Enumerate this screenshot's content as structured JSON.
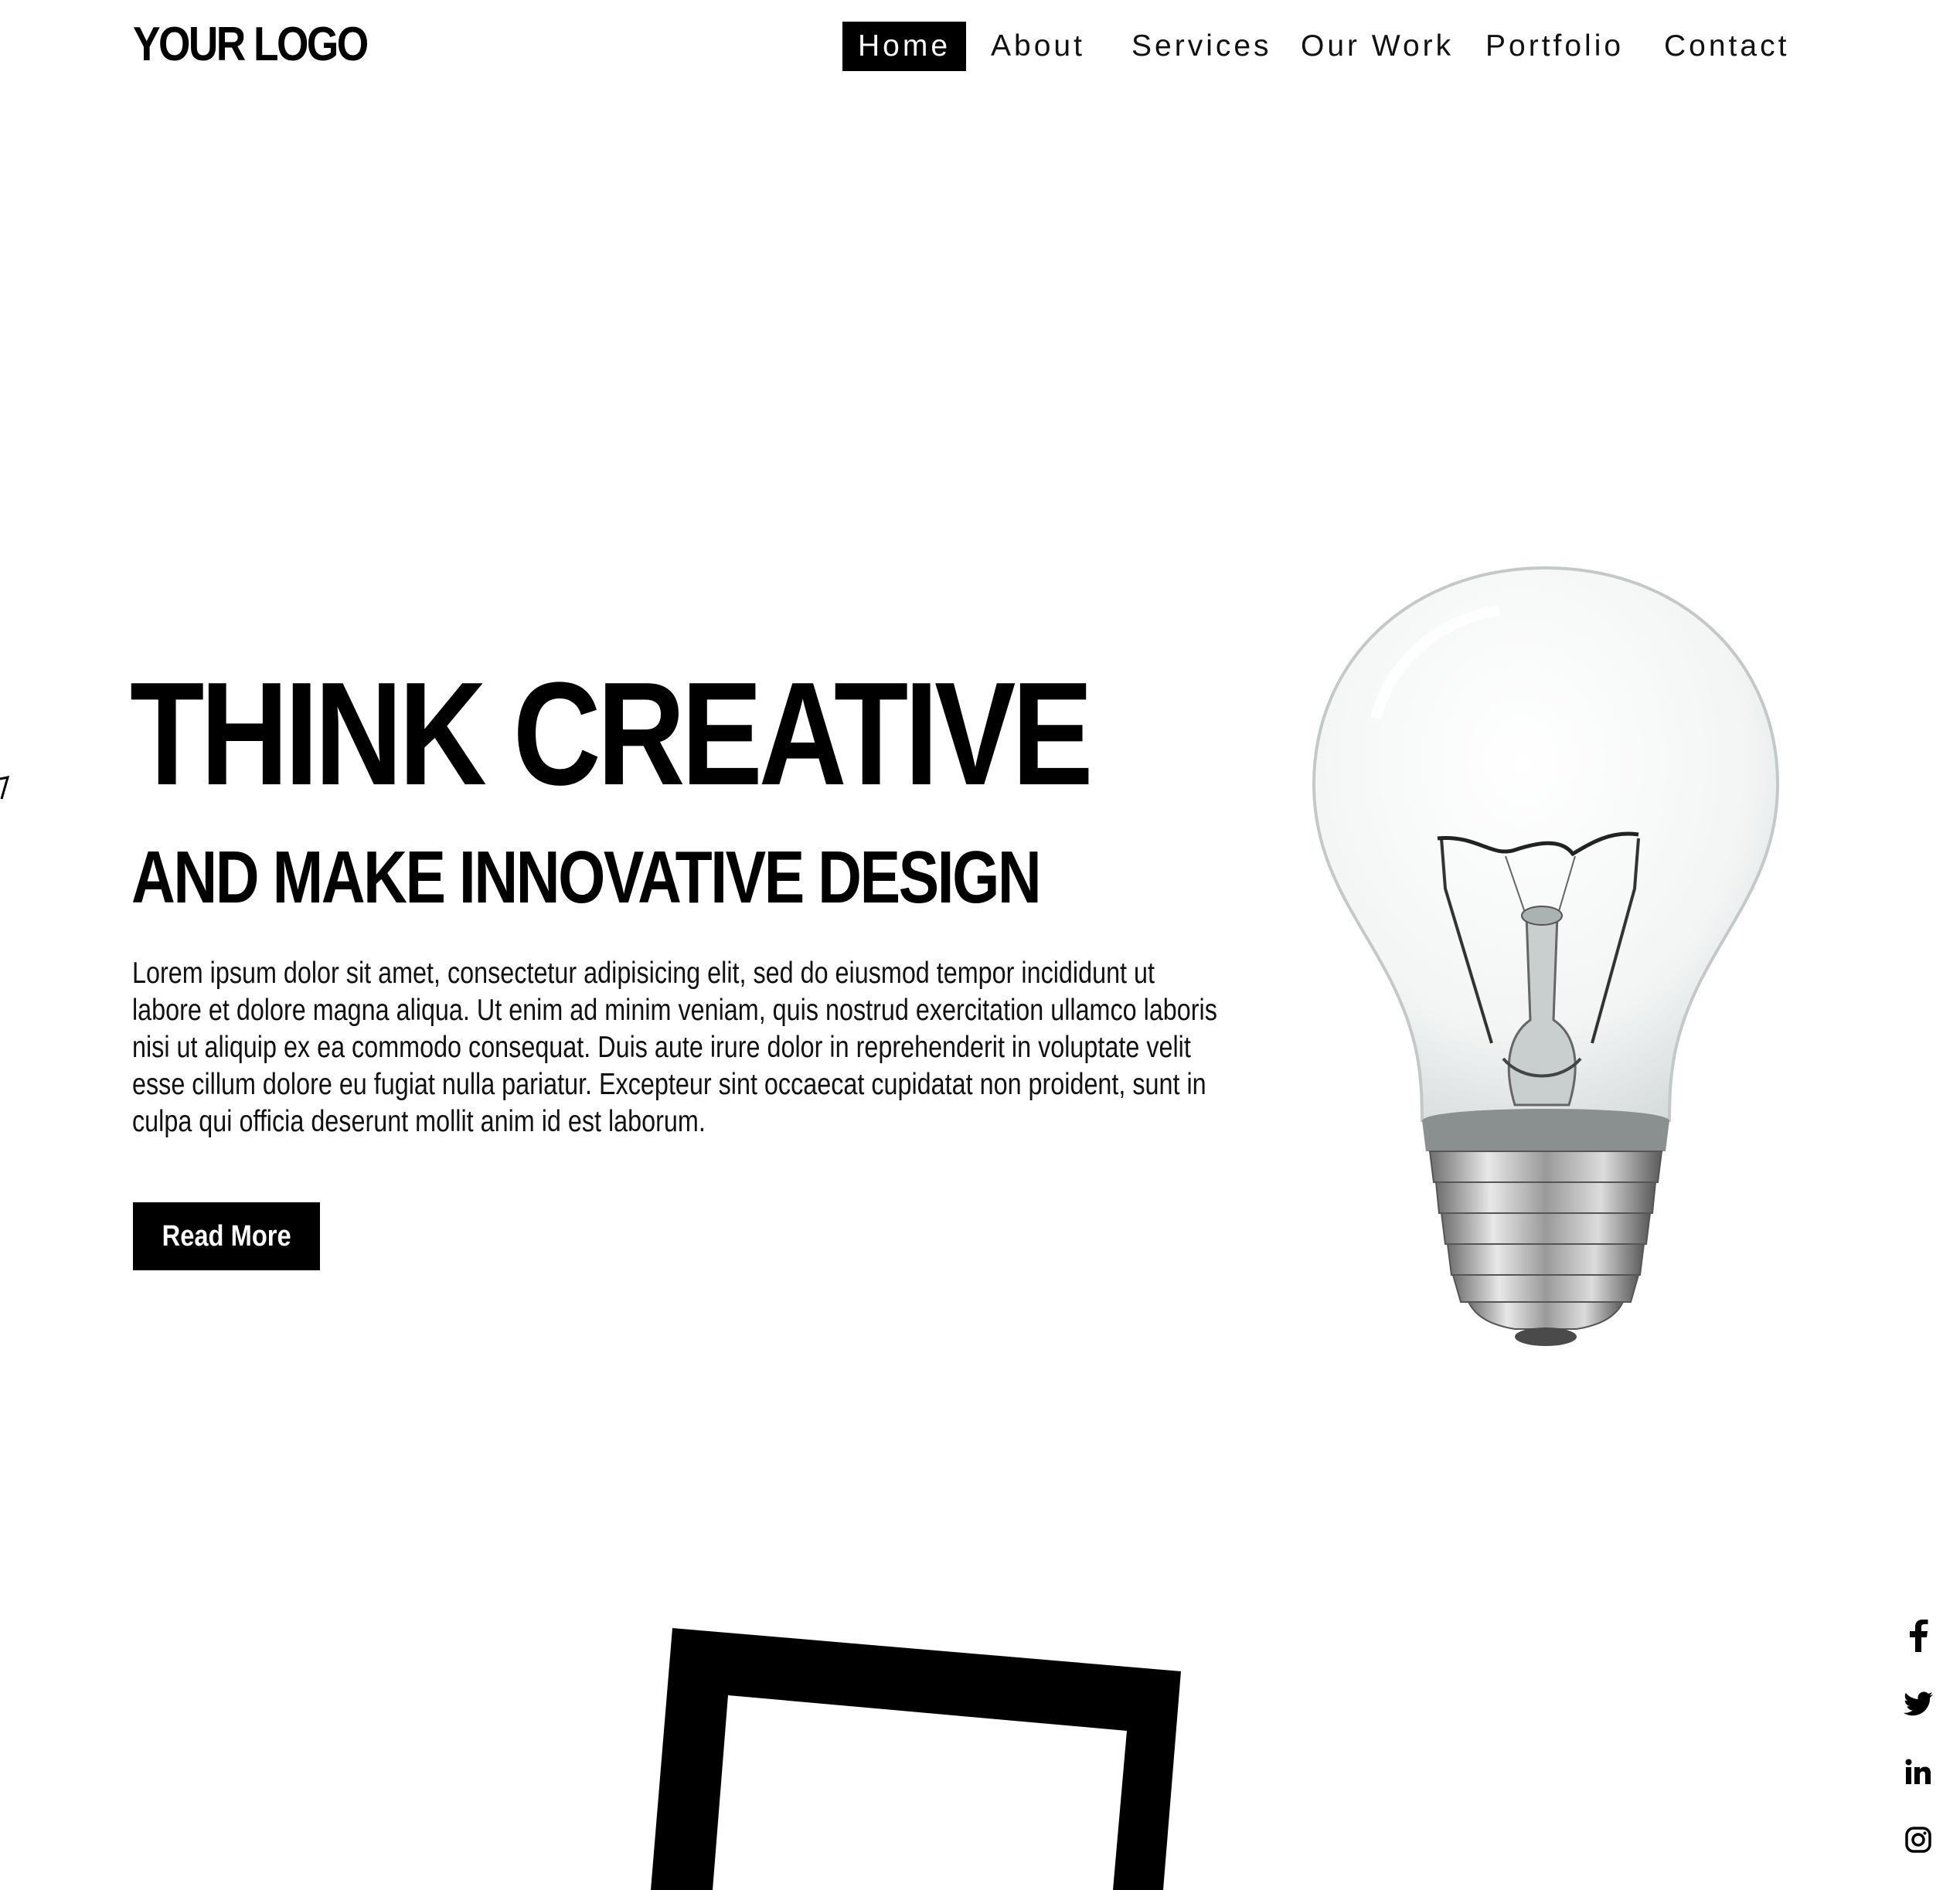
{
  "header": {
    "logo": "YOUR LOGO",
    "nav": [
      {
        "label": "Home",
        "active": true
      },
      {
        "label": "About",
        "active": false
      },
      {
        "label": "Services",
        "active": false
      },
      {
        "label": "Our Work",
        "active": false
      },
      {
        "label": "Portfolio",
        "active": false
      },
      {
        "label": "Contact",
        "active": false
      }
    ]
  },
  "hero": {
    "title": "THINK CREATIVE",
    "subtitle": "AND MAKE INNOVATIVE DESIGN",
    "body": "Lorem ipsum dolor sit amet, consectetur adipisicing elit, sed do eiusmod tempor incididunt ut labore et dolore magna aliqua. Ut enim ad minim veniam, quis nostrud exercitation ullamco laboris nisi ut aliquip ex ea commodo consequat. Duis aute irure dolor in reprehenderit in voluptate velit esse cillum dolore eu fugiat nulla pariatur. Excepteur sint occaecat cupidatat non proident, sunt in culpa qui officia deserunt mollit anim id est laborum.",
    "cta_label": "Read More",
    "image": "light-bulb-photo"
  },
  "social": {
    "icons": [
      "facebook-icon",
      "twitter-icon",
      "linkedin-icon",
      "instagram-icon"
    ]
  },
  "colors": {
    "background": "#ffffff",
    "text": "#000000",
    "accent": "#000000",
    "accent_text": "#ffffff"
  }
}
